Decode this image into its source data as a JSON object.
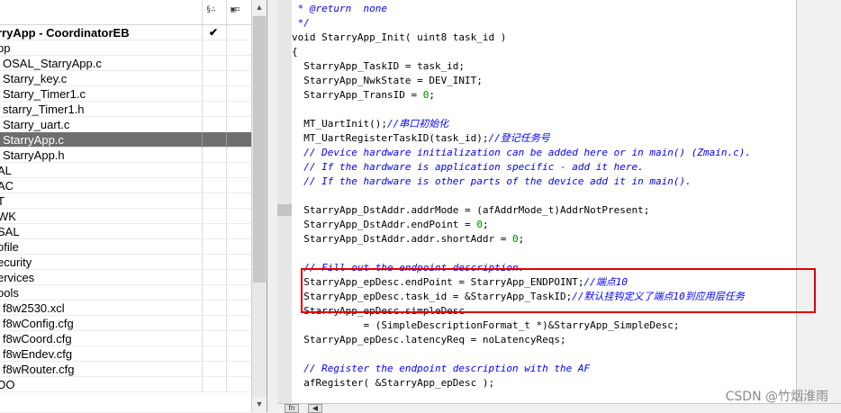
{
  "workspace": {
    "header_icons": [
      "§∴",
      "▣⌗"
    ],
    "rows": [
      {
        "label": "rryApp - CoordinatorEB",
        "indent": -3,
        "bold": true,
        "check": "✔"
      },
      {
        "label": "pp",
        "indent": -3
      },
      {
        "label": "OSAL_StarryApp.c",
        "indent": 3
      },
      {
        "label": "Starry_key.c",
        "indent": 3
      },
      {
        "label": "Starry_Timer1.c",
        "indent": 3
      },
      {
        "label": "starry_Timer1.h",
        "indent": 3
      },
      {
        "label": "Starry_uart.c",
        "indent": 3
      },
      {
        "label": "StarryApp.c",
        "indent": 3,
        "selected": true
      },
      {
        "label": "StarryApp.h",
        "indent": 3
      },
      {
        "label": "AL",
        "indent": -3
      },
      {
        "label": "AC",
        "indent": -3
      },
      {
        "label": "T",
        "indent": -3
      },
      {
        "label": "WK",
        "indent": -3
      },
      {
        "label": "SAL",
        "indent": -3
      },
      {
        "label": "ofile",
        "indent": -3
      },
      {
        "label": "ecurity",
        "indent": -3
      },
      {
        "label": "ervices",
        "indent": -3
      },
      {
        "label": "ools",
        "indent": -3
      },
      {
        "label": "f8w2530.xcl",
        "indent": 3
      },
      {
        "label": "f8wConfig.cfg",
        "indent": 3
      },
      {
        "label": "f8wCoord.cfg",
        "indent": 3
      },
      {
        "label": "f8wEndev.cfg",
        "indent": 3
      },
      {
        "label": "f8wRouter.cfg",
        "indent": 3
      },
      {
        "label": "DO",
        "indent": -3
      }
    ]
  },
  "editor": {
    "lines": [
      [
        {
          "t": " * @return  none",
          "k": "c"
        }
      ],
      [
        {
          "t": " */",
          "k": "c"
        }
      ],
      [
        {
          "t": "void StarryApp_Init( uint8 task_id )",
          "k": ""
        }
      ],
      [
        {
          "t": "{",
          "k": ""
        }
      ],
      [
        {
          "t": "  StarryApp_TaskID = task_id;",
          "k": ""
        }
      ],
      [
        {
          "t": "  StarryApp_NwkState = DEV_INIT;",
          "k": ""
        }
      ],
      [
        {
          "t": "  StarryApp_TransID = ",
          "k": ""
        },
        {
          "t": "0",
          "k": "n"
        },
        {
          "t": ";",
          "k": ""
        }
      ],
      [
        {
          "t": "",
          "k": ""
        }
      ],
      [
        {
          "t": "  MT_UartInit();",
          "k": ""
        },
        {
          "t": "//串口初始化",
          "k": "c"
        }
      ],
      [
        {
          "t": "  MT_UartRegisterTaskID(task_id);",
          "k": ""
        },
        {
          "t": "//登记任务号",
          "k": "c"
        }
      ],
      [
        {
          "t": "  // Device hardware initialization can be added here or in main() (Zmain.c).",
          "k": "c"
        }
      ],
      [
        {
          "t": "  // If the hardware is application specific - add it here.",
          "k": "c"
        }
      ],
      [
        {
          "t": "  // If the hardware is other parts of the device add it in main().",
          "k": "c"
        }
      ],
      [
        {
          "t": "",
          "k": ""
        }
      ],
      [
        {
          "t": "  StarryApp_DstAddr.addrMode = (afAddrMode_t)AddrNotPresent;",
          "k": ""
        }
      ],
      [
        {
          "t": "  StarryApp_DstAddr.endPoint = ",
          "k": ""
        },
        {
          "t": "0",
          "k": "n"
        },
        {
          "t": ";",
          "k": ""
        }
      ],
      [
        {
          "t": "  StarryApp_DstAddr.addr.shortAddr = ",
          "k": ""
        },
        {
          "t": "0",
          "k": "n"
        },
        {
          "t": ";",
          "k": ""
        }
      ],
      [
        {
          "t": "",
          "k": ""
        }
      ],
      [
        {
          "t": "  // Fill out the endpoint description.",
          "k": "c"
        }
      ],
      [
        {
          "t": "  StarryApp_epDesc.endPoint = StarryApp_ENDPOINT;",
          "k": ""
        },
        {
          "t": "//端点10",
          "k": "c"
        }
      ],
      [
        {
          "t": "  StarryApp_epDesc.task_id = &StarryApp_TaskID;",
          "k": ""
        },
        {
          "t": "//默认挂钩定义了端点10到应用层任务",
          "k": "c"
        }
      ],
      [
        {
          "t": "  StarryApp_epDesc.simpleDesc",
          "k": ""
        }
      ],
      [
        {
          "t": "            = (SimpleDescriptionFormat_t *)&StarryApp_SimpleDesc;",
          "k": ""
        }
      ],
      [
        {
          "t": "  StarryApp_epDesc.latencyReq = noLatencyReqs;",
          "k": ""
        }
      ],
      [
        {
          "t": "",
          "k": ""
        }
      ],
      [
        {
          "t": "  // Register the endpoint description with the AF",
          "k": "c"
        }
      ],
      [
        {
          "t": "  afRegister( &StarryApp_epDesc );",
          "k": ""
        }
      ]
    ]
  },
  "bottombar": {
    "buttons": [
      "fn",
      "◀"
    ]
  },
  "watermark": "CSDN @竹烟淮雨"
}
